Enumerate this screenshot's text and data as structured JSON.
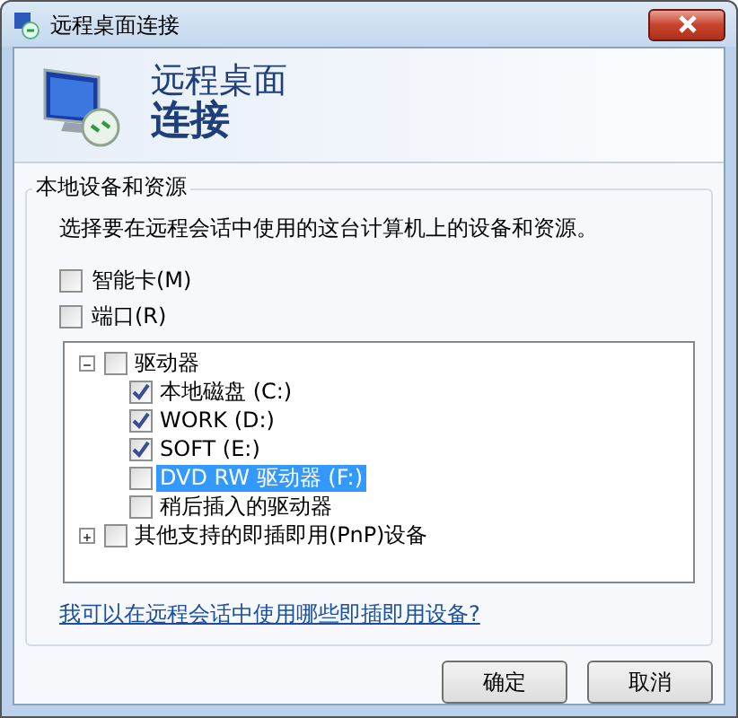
{
  "window": {
    "title": "远程桌面连接"
  },
  "header": {
    "title_line_1": "远程桌面",
    "title_line_2": "连接"
  },
  "group": {
    "title": "本地设备和资源",
    "description": "选择要在远程会话中使用的这台计算机上的设备和资源。"
  },
  "options": [
    {
      "label": "智能卡(M)",
      "checked": false
    },
    {
      "label": "端口(R)",
      "checked": false
    }
  ],
  "device_tree": [
    {
      "label": "驱动器",
      "checked": false,
      "expanded": true,
      "selected": false,
      "children": [
        {
          "label": "本地磁盘 (C:)",
          "checked": true,
          "selected": false
        },
        {
          "label": "WORK (D:)",
          "checked": true,
          "selected": false
        },
        {
          "label": "SOFT (E:)",
          "checked": true,
          "selected": false
        },
        {
          "label": "DVD RW 驱动器 (F:)",
          "checked": false,
          "selected": true
        },
        {
          "label": "稍后插入的驱动器",
          "checked": false,
          "selected": false
        }
      ]
    },
    {
      "label": "其他支持的即插即用(PnP)设备",
      "checked": false,
      "expanded": false,
      "selected": false
    }
  ],
  "help_link": "我可以在远程会话中使用哪些即插即用设备?",
  "buttons": [
    "确定",
    "取消"
  ]
}
